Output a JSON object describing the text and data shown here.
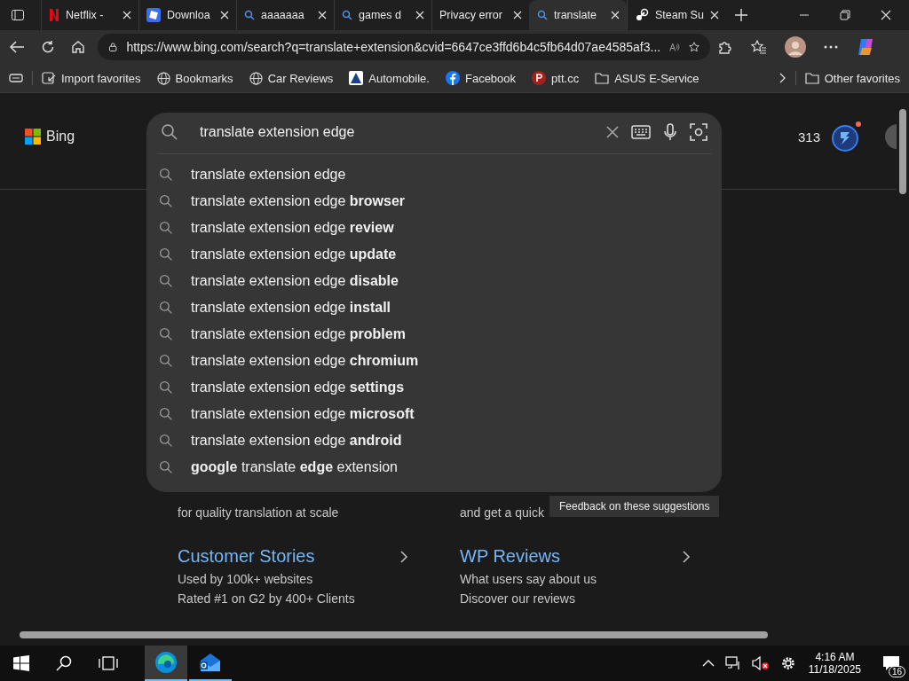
{
  "tabs": [
    {
      "label": "Netflix - ",
      "selected": false
    },
    {
      "label": "Downloa",
      "selected": false
    },
    {
      "label": "aaaaaaa",
      "selected": false
    },
    {
      "label": "games d",
      "selected": false
    },
    {
      "label": "Privacy error",
      "selected": false
    },
    {
      "label": "translate",
      "selected": true
    },
    {
      "label": "Steam Su",
      "selected": false
    }
  ],
  "address": "https://www.bing.com/search?q=translate+extension&cvid=6647ce3ffd6b4c5fb64d07ae4585af3...",
  "favorites": [
    "Import favorites",
    "Bookmarks",
    "Car Reviews",
    "Automobile.",
    "Facebook",
    "ptt.cc",
    "ASUS E-Service"
  ],
  "other_favorites": "Other favorites",
  "bing": {
    "logo": "Bing",
    "points": "313"
  },
  "search": {
    "value": "translate extension edge"
  },
  "suggestions": [
    "translate extension edge",
    "translate extension edge **browser**",
    "translate extension edge **review**",
    "translate extension edge **update**",
    "translate extension edge **disable**",
    "translate extension edge **install**",
    "translate extension edge **problem**",
    "translate extension edge **chromium**",
    "translate extension edge **settings**",
    "translate extension edge **microsoft**",
    "translate extension edge **android**",
    "**google** translate **edge** extension"
  ],
  "feedback_tooltip": "Feedback on these suggestions",
  "promo_lines": [
    "for quality translation at scale",
    "and get a quick"
  ],
  "promo_cards": [
    {
      "title": "Customer Stories",
      "lines": [
        "Used by 100k+ websites",
        "Rated #1 on G2 by 400+ Clients"
      ]
    },
    {
      "title": "WP Reviews",
      "lines": [
        "What users say about us",
        "Discover our reviews"
      ]
    }
  ],
  "taskbar": {
    "time": "4:16 AM",
    "date": "11/18/2025",
    "notifications": "16"
  }
}
